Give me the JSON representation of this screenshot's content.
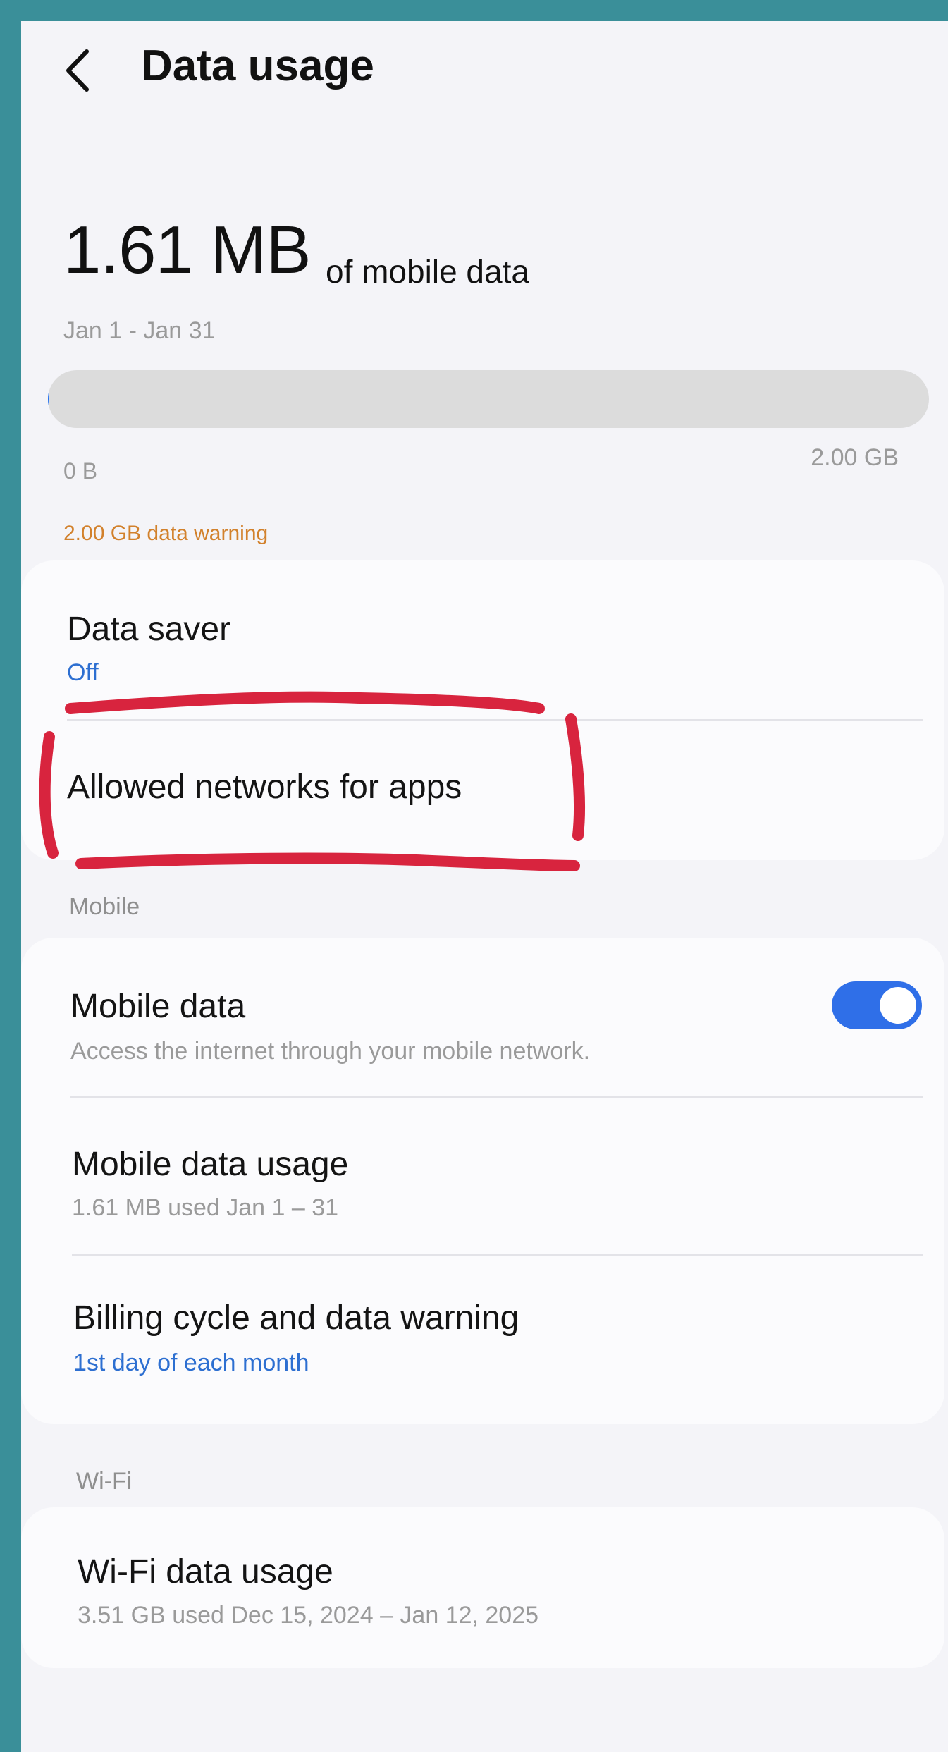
{
  "header": {
    "title": "Data usage"
  },
  "summary": {
    "amount": "1.61 MB",
    "unit_label": "of mobile data",
    "period": "Jan 1 - Jan 31",
    "bar_min": "0 B",
    "bar_max": "2.00 GB",
    "usage_fraction": 0.0008,
    "warning": "2.00 GB data warning"
  },
  "settings": {
    "data_saver": {
      "title": "Data saver",
      "value": "Off"
    },
    "allowed_networks": {
      "title": "Allowed networks for apps"
    }
  },
  "mobile_section": {
    "header": "Mobile",
    "mobile_data": {
      "title": "Mobile data",
      "subtitle": "Access the internet through your mobile network.",
      "enabled": true
    },
    "mobile_data_usage": {
      "title": "Mobile data usage",
      "subtitle": "1.61 MB used Jan 1 – 31"
    },
    "billing": {
      "title": "Billing cycle and data warning",
      "value": "1st day of each month"
    }
  },
  "wifi_section": {
    "header": "Wi-Fi",
    "wifi_data_usage": {
      "title": "Wi-Fi data usage",
      "subtitle": "3.51 GB used Dec 15, 2024 – Jan 12, 2025"
    }
  },
  "colors": {
    "accent": "#2f6fe8",
    "link_blue": "#2d6fd1",
    "warning_orange": "#d2812c",
    "annotation_red": "#d8243e",
    "frame_teal": "#3a8f99"
  },
  "icons": {
    "back": "chevron-left-icon"
  }
}
